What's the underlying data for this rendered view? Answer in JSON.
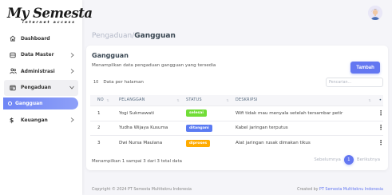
{
  "brand": {
    "logo_main": "My Semesta",
    "logo_sub": "internet access"
  },
  "sidebar": {
    "items": [
      {
        "label": "Dashboard",
        "icon": "home-icon",
        "has_chevron": false
      },
      {
        "label": "Data Master",
        "icon": "database-icon",
        "has_chevron": true
      },
      {
        "label": "Administrasi",
        "icon": "users-icon",
        "has_chevron": true
      },
      {
        "label": "Pengaduan",
        "icon": "window-icon",
        "has_chevron": true,
        "open": true
      },
      {
        "label": "Gangguan",
        "icon": "circle-icon",
        "active": true
      },
      {
        "label": "Keuangan",
        "icon": "dollar-icon",
        "has_chevron": true
      }
    ]
  },
  "header": {
    "breadcrumb_parent": "Pengaduan/",
    "breadcrumb_current": "Gangguan"
  },
  "card": {
    "title": "Gangguan",
    "description": "Menampilkan data pengaduan gangguan yang tersedia",
    "add_button": "Tambah",
    "page_length": "10",
    "page_length_label": "Data per halaman",
    "search_placeholder": "Pencarian..."
  },
  "table": {
    "headers": [
      "NO",
      "PELANGGAN",
      "STATUS",
      "DESKRIPSI"
    ],
    "rows": [
      {
        "no": "1",
        "pelanggan": "Yogi Sukmawati",
        "status": "selesai",
        "status_color": "#71dd37",
        "deskripsi": "Wifi tidak mau menyala setelah tersambar petir"
      },
      {
        "no": "2",
        "pelanggan": "Yudha Wijaya Kusuma",
        "status": "ditangani",
        "status_color": "#5b7bf2",
        "deskripsi": "Kabel jaringan terputus"
      },
      {
        "no": "3",
        "pelanggan": "Dwi Nursa Maulana",
        "status": "diproses",
        "status_color": "#ffab00",
        "deskripsi": "Alat jaringan rusak dimakan tikus"
      }
    ]
  },
  "footer_table": {
    "info": "Menampilkan 1 sampai 3 dari 3 total data",
    "prev": "Sebelumnya",
    "page": "1",
    "next": "Berikutnya"
  },
  "footer": {
    "copyright": "Copyright © 2024 PT Semesta Multiteknu Indonesia",
    "created_prefix": "Created by ",
    "created_link": "PT Semesta Multiteknu Indonesia"
  },
  "colors": {
    "accent": "#6377f1",
    "background": "#f5f5f9"
  }
}
